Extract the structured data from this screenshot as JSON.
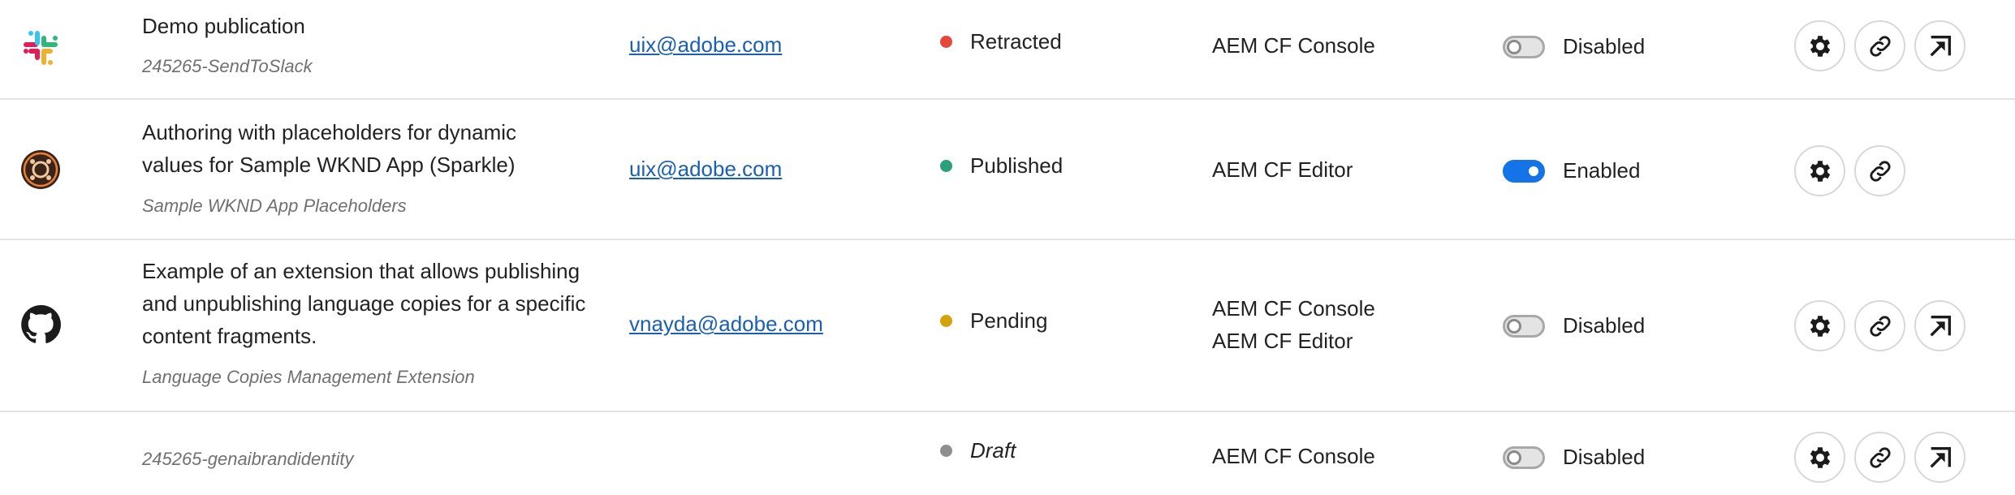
{
  "colors": {
    "retracted": "#e5473d",
    "published": "#2b9f77",
    "pending": "#d3a20c",
    "draft": "#8e8e8e",
    "link": "#1a5fb4",
    "toggle_on": "#1473e6"
  },
  "rows": [
    {
      "icon": "slack-icon",
      "title": "Demo publication",
      "subtitle": "245265-SendToSlack",
      "email": "uix@adobe.com",
      "status": "Retracted",
      "extension_points": [
        "AEM CF Console"
      ],
      "enabled": false,
      "toggle_label": "Disabled",
      "actions": [
        "settings-icon",
        "link-icon",
        "open-external-icon"
      ]
    },
    {
      "icon": "sparkle-app-icon",
      "title_lines": [
        "Authoring with placeholders for dynamic",
        "values for Sample WKND App (Sparkle)"
      ],
      "subtitle": "Sample WKND App Placeholders",
      "email": "uix@adobe.com",
      "status": "Published",
      "extension_points": [
        "AEM CF Editor"
      ],
      "enabled": true,
      "toggle_label": "Enabled",
      "actions": [
        "settings-icon",
        "link-icon"
      ]
    },
    {
      "icon": "github-icon",
      "title_lines": [
        "Example of an extension that allows publishing",
        "and unpublishing language copies for a specific",
        "content fragments."
      ],
      "subtitle": "Language Copies Management Extension",
      "email": "vnayda@adobe.com",
      "status": "Pending",
      "extension_points": [
        "AEM CF Console",
        "AEM CF Editor"
      ],
      "enabled": false,
      "toggle_label": "Disabled",
      "actions": [
        "settings-icon",
        "link-icon",
        "open-external-icon"
      ]
    },
    {
      "icon": "",
      "subtitle": "245265-genaibrandidentity",
      "status": "Draft",
      "extension_points": [
        "AEM CF Console"
      ],
      "enabled": false,
      "toggle_label": "Disabled",
      "actions": [
        "settings-icon",
        "link-icon",
        "open-external-icon"
      ]
    }
  ]
}
